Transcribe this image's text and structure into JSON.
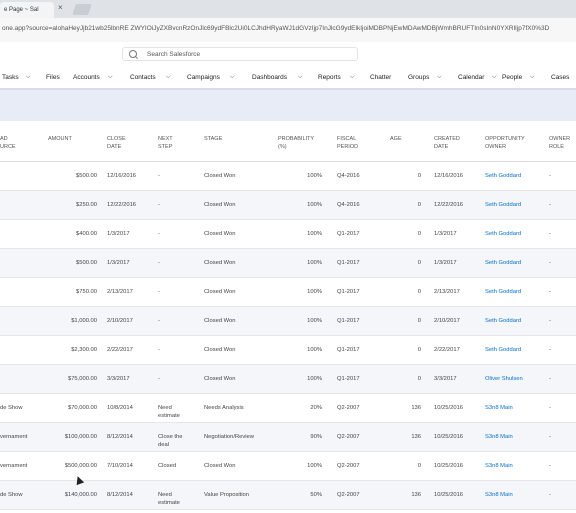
{
  "browser": {
    "tab_title": "e Page ~ Sal",
    "close_glyph": "×",
    "url": "one.app?source=alohaHeyJjb21wb25lbnRE ZWYIOiJyZXBvcnRzOnJlc69ydFBlc2Ui0LCJhdHRyaWJ1dGVzIjp7InJlcG9ydElkIjoiMDBPNjEwMDAwMDBjWmhBRUFTIn0sInN0YXRlIjp7fX0%3D"
  },
  "header": {
    "search_placeholder": "Search Salesforce"
  },
  "nav": {
    "items": [
      "Tasks",
      "Files",
      "Accounts",
      "Contacts",
      "Campaigns",
      "Dashboards",
      "Reports",
      "Chatter",
      "Groups",
      "Calendar",
      "People",
      "Cases"
    ]
  },
  "table": {
    "headers": {
      "lead_source": "AD\nURCE",
      "amount": "AMOUNT",
      "close_date": "CLOSE\nDATE",
      "next_step": "NEXT\nSTEP",
      "stage": "STAGE",
      "probability": "PROBABILITY\n(%)",
      "fiscal_period": "FISCAL\nPERIOD",
      "age": "AGE",
      "created_date": "CREATED\nDATE",
      "owner": "OPPORTUNITY\nOWNER",
      "owner_role": "OWNER\nROLE"
    },
    "rows": [
      {
        "source": "",
        "amount": "$500.00",
        "close": "12/16/2016",
        "next": "-",
        "stage": "Closed Won",
        "prob": "100%",
        "fiscal": "Q4-2016",
        "age": "0",
        "created": "12/16/2016",
        "owner": "Seth Goddard",
        "role": "-"
      },
      {
        "source": "",
        "amount": "$250.00",
        "close": "12/22/2016",
        "next": "-",
        "stage": "Closed Won",
        "prob": "100%",
        "fiscal": "Q4-2016",
        "age": "0",
        "created": "12/22/2016",
        "owner": "Seth Goddard",
        "role": "-"
      },
      {
        "source": "",
        "amount": "$400.00",
        "close": "1/3/2017",
        "next": "-",
        "stage": "Closed Won",
        "prob": "100%",
        "fiscal": "Q1-2017",
        "age": "0",
        "created": "1/3/2017",
        "owner": "Seth Goddard",
        "role": "-"
      },
      {
        "source": "",
        "amount": "$500.00",
        "close": "1/3/2017",
        "next": "-",
        "stage": "Closed Won",
        "prob": "100%",
        "fiscal": "Q1-2017",
        "age": "0",
        "created": "1/3/2017",
        "owner": "Seth Goddard",
        "role": "-"
      },
      {
        "source": "",
        "amount": "$750.00",
        "close": "2/13/2017",
        "next": "-",
        "stage": "Closed Won",
        "prob": "100%",
        "fiscal": "Q1-2017",
        "age": "0",
        "created": "2/13/2017",
        "owner": "Seth Goddard",
        "role": "-"
      },
      {
        "source": "",
        "amount": "$1,000.00",
        "close": "2/10/2017",
        "next": "-",
        "stage": "Closed Won",
        "prob": "100%",
        "fiscal": "Q1-2017",
        "age": "0",
        "created": "2/10/2017",
        "owner": "Seth Goddard",
        "role": "-"
      },
      {
        "source": "",
        "amount": "$2,300.00",
        "close": "2/22/2017",
        "next": "-",
        "stage": "Closed Won",
        "prob": "100%",
        "fiscal": "Q1-2017",
        "age": "0",
        "created": "2/22/2017",
        "owner": "Seth Goddard",
        "role": "-"
      },
      {
        "source": "",
        "amount": "$75,000.00",
        "close": "3/3/2017",
        "next": "-",
        "stage": "Closed Won",
        "prob": "100%",
        "fiscal": "Q1-2017",
        "age": "0",
        "created": "3/3/2017",
        "owner": "Oliver Shulsen",
        "role": "-"
      },
      {
        "source": "de Show",
        "amount": "$70,000.00",
        "close": "10/8/2014",
        "next": "Need\nestimate",
        "stage": "Needs Analysis",
        "prob": "20%",
        "fiscal": "Q2-2007",
        "age": "136",
        "created": "10/25/2016",
        "owner": "S3n8 Main",
        "role": "-"
      },
      {
        "source": "vernament",
        "amount": "$100,000.00",
        "close": "8/12/2014",
        "next": "Close the\ndeal",
        "stage": "Negotiation/Review",
        "prob": "90%",
        "fiscal": "Q2-2007",
        "age": "136",
        "created": "10/25/2016",
        "owner": "S3n8 Main",
        "role": "-"
      },
      {
        "source": "vernament",
        "amount": "$500,000.00",
        "close": "7/10/2014",
        "next": "Closed",
        "stage": "Closed Won",
        "prob": "100%",
        "fiscal": "Q2-2007",
        "age": "0",
        "created": "10/25/2016",
        "owner": "S3n8 Main",
        "role": "-"
      },
      {
        "source": "de Show",
        "amount": "$140,000.00",
        "close": "8/12/2014",
        "next": "Need\nestimate",
        "stage": "Value Proposition",
        "prob": "50%",
        "fiscal": "Q2-2007",
        "age": "136",
        "created": "10/25/2016",
        "owner": "S3n8 Main",
        "role": "-"
      }
    ]
  }
}
